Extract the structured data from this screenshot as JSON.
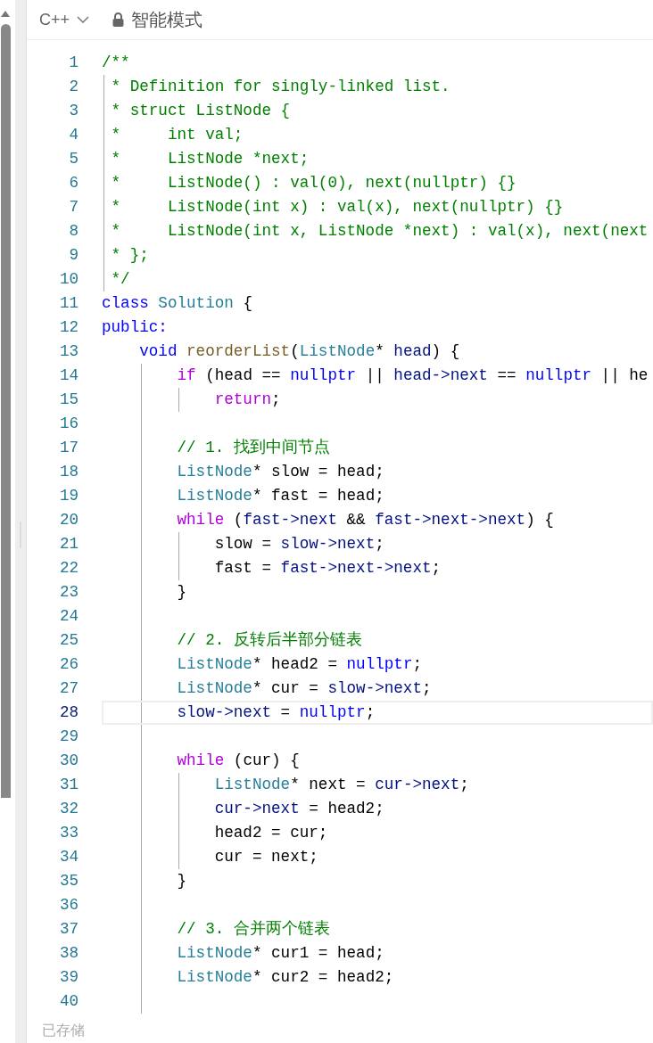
{
  "toolbar": {
    "language": "C++",
    "mode": "智能模式"
  },
  "editor": {
    "lines": [
      {
        "number": "1",
        "selected": false,
        "tokens": [
          {
            "kind": "comment",
            "text": "/**"
          }
        ]
      },
      {
        "number": "2",
        "selected": false,
        "tokens": [
          {
            "kind": "comment",
            "text": " * Definition for singly-linked list."
          }
        ]
      },
      {
        "number": "3",
        "selected": false,
        "tokens": [
          {
            "kind": "comment",
            "text": " * struct ListNode {"
          }
        ]
      },
      {
        "number": "4",
        "selected": false,
        "tokens": [
          {
            "kind": "comment",
            "text": " *     int val;"
          }
        ]
      },
      {
        "number": "5",
        "selected": false,
        "tokens": [
          {
            "kind": "comment",
            "text": " *     ListNode *next;"
          }
        ]
      },
      {
        "number": "6",
        "selected": false,
        "tokens": [
          {
            "kind": "comment",
            "text": " *     ListNode() : val(0), next(nullptr) {}"
          }
        ]
      },
      {
        "number": "7",
        "selected": false,
        "tokens": [
          {
            "kind": "comment",
            "text": " *     ListNode(int x) : val(x), next(nullptr) {}"
          }
        ]
      },
      {
        "number": "8",
        "selected": false,
        "tokens": [
          {
            "kind": "comment",
            "text": " *     ListNode(int x, ListNode *next) : val(x), next(next"
          }
        ]
      },
      {
        "number": "9",
        "selected": false,
        "tokens": [
          {
            "kind": "comment",
            "text": " * };"
          }
        ]
      },
      {
        "number": "10",
        "selected": false,
        "tokens": [
          {
            "kind": "comment",
            "text": " */"
          }
        ]
      },
      {
        "number": "11",
        "selected": false,
        "tokens": [
          {
            "kind": "keyword",
            "text": "class"
          },
          {
            "kind": "type",
            "text": " Solution"
          },
          {
            "kind": "plain",
            "text": " {"
          }
        ]
      },
      {
        "number": "12",
        "selected": false,
        "tokens": [
          {
            "kind": "keyword",
            "text": "public:"
          }
        ]
      },
      {
        "number": "13",
        "selected": false,
        "tokens": [
          {
            "kind": "keyword",
            "text": "    void"
          },
          {
            "kind": "func",
            "text": " reorderList"
          },
          {
            "kind": "plain",
            "text": "("
          },
          {
            "kind": "type",
            "text": "ListNode"
          },
          {
            "kind": "plain",
            "text": "* "
          },
          {
            "kind": "var",
            "text": "head"
          },
          {
            "kind": "plain",
            "text": ") {"
          }
        ]
      },
      {
        "number": "14",
        "selected": false,
        "tokens": [
          {
            "kind": "control",
            "text": "        if"
          },
          {
            "kind": "plain",
            "text": " (head == "
          },
          {
            "kind": "keyword",
            "text": "nullptr"
          },
          {
            "kind": "plain",
            "text": " || "
          },
          {
            "kind": "var",
            "text": "head->next"
          },
          {
            "kind": "plain",
            "text": " == "
          },
          {
            "kind": "keyword",
            "text": "nullptr"
          },
          {
            "kind": "plain",
            "text": " || he"
          }
        ]
      },
      {
        "number": "15",
        "selected": false,
        "tokens": [
          {
            "kind": "control",
            "text": "            return"
          },
          {
            "kind": "plain",
            "text": ";"
          }
        ]
      },
      {
        "number": "16",
        "selected": false
      },
      {
        "number": "17",
        "selected": false,
        "tokens": [
          {
            "kind": "comment",
            "text": "        // 1. 找到中间节点"
          }
        ]
      },
      {
        "number": "18",
        "selected": false,
        "tokens": [
          {
            "kind": "type",
            "text": "        ListNode"
          },
          {
            "kind": "plain",
            "text": "* slow = head;"
          }
        ]
      },
      {
        "number": "19",
        "selected": false,
        "tokens": [
          {
            "kind": "type",
            "text": "        ListNode"
          },
          {
            "kind": "plain",
            "text": "* fast = head;"
          }
        ]
      },
      {
        "number": "20",
        "selected": false,
        "tokens": [
          {
            "kind": "control",
            "text": "        while"
          },
          {
            "kind": "plain",
            "text": " ("
          },
          {
            "kind": "var",
            "text": "fast->next"
          },
          {
            "kind": "plain",
            "text": " && "
          },
          {
            "kind": "var",
            "text": "fast->next->next"
          },
          {
            "kind": "plain",
            "text": ") {"
          }
        ]
      },
      {
        "number": "21",
        "selected": false,
        "tokens": [
          {
            "kind": "plain",
            "text": "            slow = "
          },
          {
            "kind": "var",
            "text": "slow->next"
          },
          {
            "kind": "plain",
            "text": ";"
          }
        ]
      },
      {
        "number": "22",
        "selected": false,
        "tokens": [
          {
            "kind": "plain",
            "text": "            fast = "
          },
          {
            "kind": "var",
            "text": "fast->next->next"
          },
          {
            "kind": "plain",
            "text": ";"
          }
        ]
      },
      {
        "number": "23",
        "selected": false,
        "tokens": [
          {
            "kind": "plain",
            "text": "        }"
          }
        ]
      },
      {
        "number": "24",
        "selected": false
      },
      {
        "number": "25",
        "selected": false,
        "tokens": [
          {
            "kind": "comment",
            "text": "        // 2. 反转后半部分链表"
          }
        ]
      },
      {
        "number": "26",
        "selected": false,
        "tokens": [
          {
            "kind": "type",
            "text": "        ListNode"
          },
          {
            "kind": "plain",
            "text": "* head2 = "
          },
          {
            "kind": "keyword",
            "text": "nullptr"
          },
          {
            "kind": "plain",
            "text": ";"
          }
        ]
      },
      {
        "number": "27",
        "selected": false,
        "tokens": [
          {
            "kind": "type",
            "text": "        ListNode"
          },
          {
            "kind": "plain",
            "text": "* cur = "
          },
          {
            "kind": "var",
            "text": "slow->next"
          },
          {
            "kind": "plain",
            "text": ";"
          }
        ]
      },
      {
        "number": "28",
        "selected": true,
        "tokens": [
          {
            "kind": "var",
            "text": "        slow->next"
          },
          {
            "kind": "plain",
            "text": " = "
          },
          {
            "kind": "keyword",
            "text": "nullptr"
          },
          {
            "kind": "plain",
            "text": ";"
          }
        ]
      },
      {
        "number": "29",
        "selected": false
      },
      {
        "number": "30",
        "selected": false,
        "tokens": [
          {
            "kind": "control",
            "text": "        while"
          },
          {
            "kind": "plain",
            "text": " (cur) {"
          }
        ]
      },
      {
        "number": "31",
        "selected": false,
        "tokens": [
          {
            "kind": "type",
            "text": "            ListNode"
          },
          {
            "kind": "plain",
            "text": "* next = "
          },
          {
            "kind": "var",
            "text": "cur->next"
          },
          {
            "kind": "plain",
            "text": ";"
          }
        ]
      },
      {
        "number": "32",
        "selected": false,
        "tokens": [
          {
            "kind": "var",
            "text": "            cur->next"
          },
          {
            "kind": "plain",
            "text": " = head2;"
          }
        ]
      },
      {
        "number": "33",
        "selected": false,
        "tokens": [
          {
            "kind": "plain",
            "text": "            head2 = cur;"
          }
        ]
      },
      {
        "number": "34",
        "selected": false,
        "tokens": [
          {
            "kind": "plain",
            "text": "            cur = next;"
          }
        ]
      },
      {
        "number": "35",
        "selected": false,
        "tokens": [
          {
            "kind": "plain",
            "text": "        }"
          }
        ]
      },
      {
        "number": "36",
        "selected": false
      },
      {
        "number": "37",
        "selected": false,
        "tokens": [
          {
            "kind": "comment",
            "text": "        // 3. 合并两个链表"
          }
        ]
      },
      {
        "number": "38",
        "selected": false,
        "tokens": [
          {
            "kind": "type",
            "text": "        ListNode"
          },
          {
            "kind": "plain",
            "text": "* cur1 = head;"
          }
        ]
      },
      {
        "number": "39",
        "selected": false,
        "tokens": [
          {
            "kind": "type",
            "text": "        ListNode"
          },
          {
            "kind": "plain",
            "text": "* cur2 = head2;"
          }
        ]
      },
      {
        "number": "40",
        "selected": false
      }
    ]
  },
  "status": "已存储"
}
